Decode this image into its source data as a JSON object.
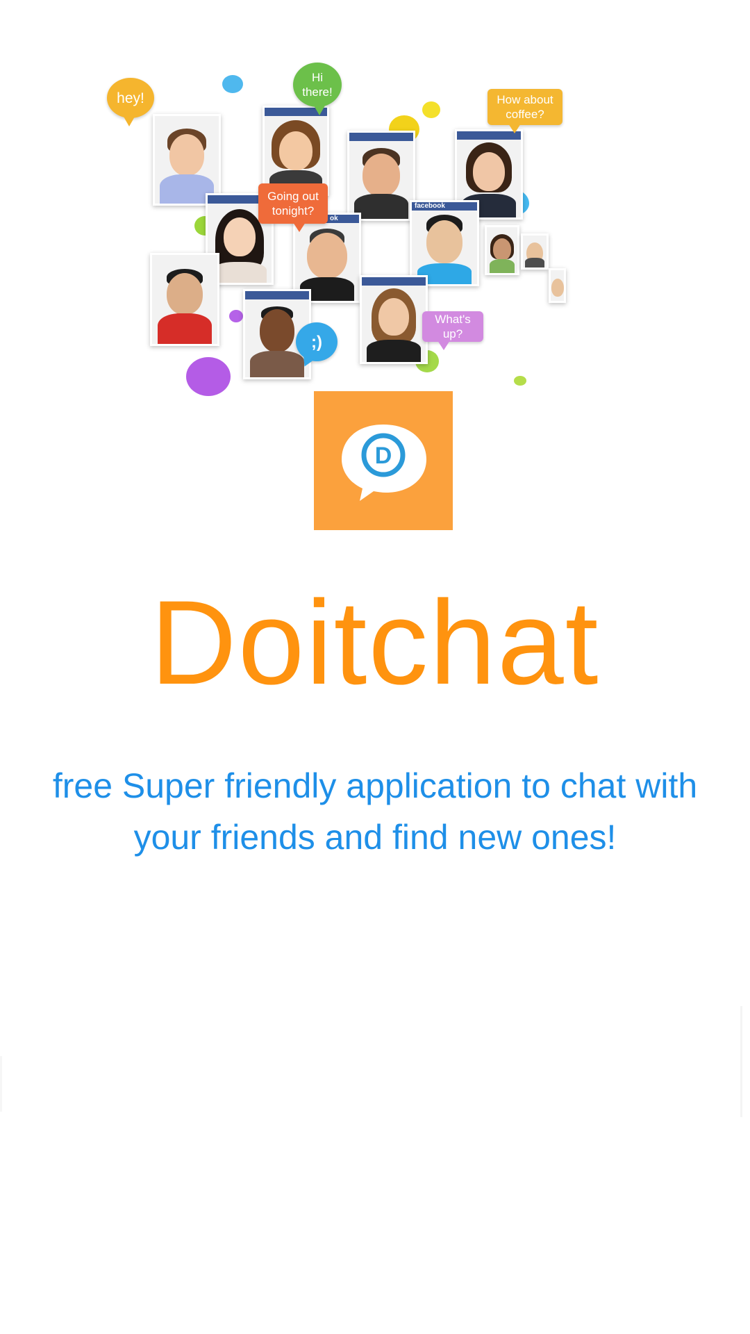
{
  "hero": {
    "bubbles": {
      "hey": "hey!",
      "hi": "Hi there!",
      "coffee": "How about coffee?",
      "going_out": "Going out tonight?",
      "whats_up": "What's up?",
      "smile": ";)"
    },
    "photo_labels": {
      "facebook": "facebook",
      "ook": "ok"
    }
  },
  "app": {
    "icon_name": "doitchat-logo-icon",
    "icon_letter": "D",
    "title": "Doitchat",
    "tagline_line1": "free Super friendly application to chat with",
    "tagline_line2": "your friends and find new ones!"
  },
  "colors": {
    "brand_orange": "#ff930f",
    "icon_background": "#fba13d",
    "tagline_blue": "#1e8fe8",
    "icon_ring_blue": "#2b9ad9"
  }
}
